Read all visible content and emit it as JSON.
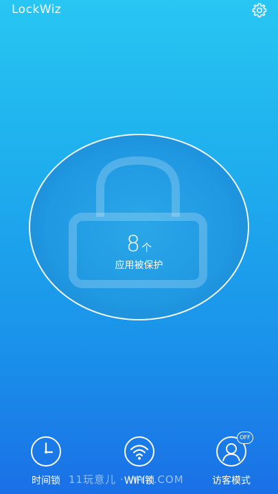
{
  "header": {
    "app_title": "LockWiz",
    "settings_icon": "gear-icon"
  },
  "status": {
    "count": "8",
    "count_unit": "个",
    "label": "应用被保护"
  },
  "bottom_nav": [
    {
      "label": "时间锁",
      "icon": "clock-icon"
    },
    {
      "label": "WIFI锁",
      "icon": "wifi-icon"
    },
    {
      "label": "访客模式",
      "icon": "guest-icon",
      "badge": "OFF"
    }
  ],
  "watermark": "11玩意儿 · WYX.COM",
  "colors": {
    "bg_top": "#28c6f2",
    "bg_bottom": "#1a70e6",
    "accent": "#ffffff"
  }
}
